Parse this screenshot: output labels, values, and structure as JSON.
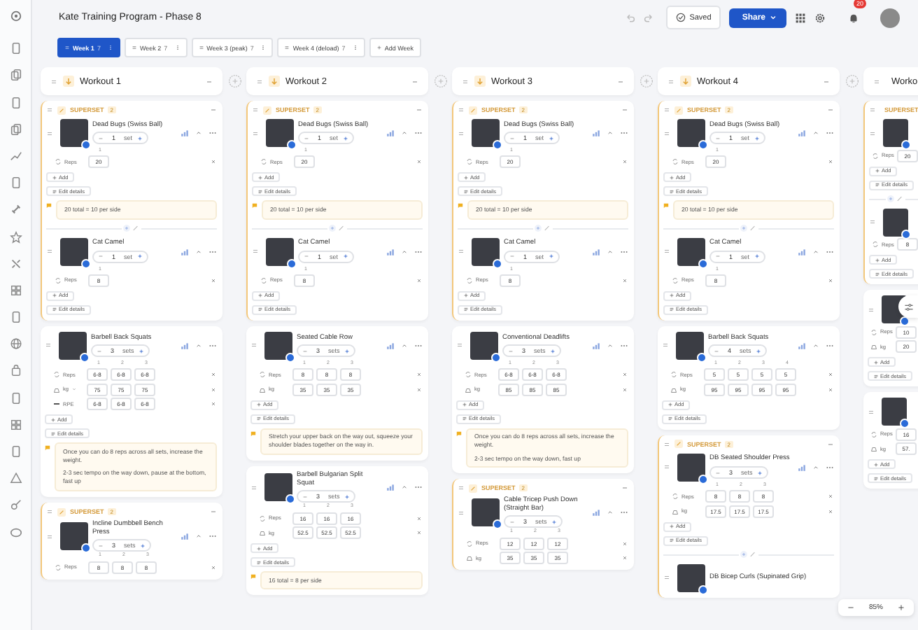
{
  "app_title": "Kate Training Program - Phase 8",
  "header": {
    "saved": "Saved",
    "share": "Share",
    "notifications": "20"
  },
  "weeks": [
    {
      "label": "Week 1",
      "count": "7",
      "selected": true
    },
    {
      "label": "Week 2",
      "count": "7",
      "selected": false
    },
    {
      "label": "Week 3 (peak)",
      "count": "7",
      "selected": false
    },
    {
      "label": "Week 4 (deload)",
      "count": "7",
      "selected": false
    }
  ],
  "add_week": "Add Week",
  "workouts": [
    {
      "title": "Workout 1",
      "blocks": [
        {
          "kind": "superset",
          "label": "SUPERSET",
          "count": "2",
          "exercises": [
            {
              "name": "Dead Bugs (Swiss Ball)",
              "sets": "1",
              "unit": "set",
              "set_numbers": [
                "1"
              ],
              "rows": [
                {
                  "kind": "reps",
                  "label": "Reps",
                  "values": [
                    "20"
                  ]
                }
              ],
              "add": "Add",
              "edit": "Edit details",
              "note": [
                "20 total = 10 per side"
              ]
            },
            {
              "name": "Cat Camel",
              "sets": "1",
              "unit": "set",
              "set_numbers": [
                "1"
              ],
              "rows": [
                {
                  "kind": "reps",
                  "label": "Reps",
                  "values": [
                    "8"
                  ]
                }
              ],
              "add": "Add",
              "edit": "Edit details"
            }
          ]
        },
        {
          "kind": "single",
          "exercises": [
            {
              "name": "Barbell Back Squats",
              "sets": "3",
              "unit": "sets",
              "set_numbers": [
                "1",
                "2",
                "3"
              ],
              "rows": [
                {
                  "kind": "reps",
                  "label": "Reps",
                  "values": [
                    "6-8",
                    "6-8",
                    "6-8"
                  ]
                },
                {
                  "kind": "weight",
                  "label": "kg",
                  "dropdown": true,
                  "values": [
                    "75",
                    "75",
                    "75"
                  ]
                },
                {
                  "kind": "rpe",
                  "label": "RPE",
                  "values": [
                    "6-8",
                    "6-8",
                    "6-8"
                  ]
                }
              ],
              "add": "Add",
              "edit": "Edit details",
              "note": [
                "Once you can do 8 reps across all sets, increase the weight.",
                "2-3 sec tempo on the way down, pause at the bottom, fast up"
              ]
            }
          ]
        },
        {
          "kind": "superset",
          "label": "SUPERSET",
          "count": "2",
          "exercises": [
            {
              "name": "Incline Dumbbell Bench Press",
              "sets": "3",
              "unit": "sets",
              "set_numbers": [
                "1",
                "2",
                "3"
              ],
              "rows": [
                {
                  "kind": "reps",
                  "label": "Reps",
                  "values": [
                    "8",
                    "8",
                    "8"
                  ]
                }
              ]
            }
          ]
        }
      ]
    },
    {
      "title": "Workout 2",
      "blocks": [
        {
          "kind": "superset",
          "label": "SUPERSET",
          "count": "2",
          "exercises": [
            {
              "name": "Dead Bugs (Swiss Ball)",
              "sets": "1",
              "unit": "set",
              "set_numbers": [
                "1"
              ],
              "rows": [
                {
                  "kind": "reps",
                  "label": "Reps",
                  "values": [
                    "20"
                  ]
                }
              ],
              "add": "Add",
              "edit": "Edit details",
              "note": [
                "20 total = 10 per side"
              ]
            },
            {
              "name": "Cat Camel",
              "sets": "1",
              "unit": "set",
              "set_numbers": [
                "1"
              ],
              "rows": [
                {
                  "kind": "reps",
                  "label": "Reps",
                  "values": [
                    "8"
                  ]
                }
              ],
              "add": "Add",
              "edit": "Edit details"
            }
          ]
        },
        {
          "kind": "single",
          "exercises": [
            {
              "name": "Seated Cable Row",
              "sets": "3",
              "unit": "sets",
              "set_numbers": [
                "1",
                "2",
                "3"
              ],
              "rows": [
                {
                  "kind": "reps",
                  "label": "Reps",
                  "values": [
                    "8",
                    "8",
                    "8"
                  ]
                },
                {
                  "kind": "weight",
                  "label": "kg",
                  "values": [
                    "35",
                    "35",
                    "35"
                  ]
                }
              ],
              "add": "Add",
              "edit": "Edit details",
              "note": [
                "Stretch your upper back on the way out, squeeze your shoulder blades together on the way in."
              ]
            }
          ]
        },
        {
          "kind": "single",
          "exercises": [
            {
              "name": "Barbell Bulgarian Split Squat",
              "sets": "3",
              "unit": "sets",
              "set_numbers": [
                "1",
                "2",
                "3"
              ],
              "rows": [
                {
                  "kind": "reps",
                  "label": "Reps",
                  "values": [
                    "16",
                    "16",
                    "16"
                  ]
                },
                {
                  "kind": "weight",
                  "label": "kg",
                  "values": [
                    "52.5",
                    "52.5",
                    "52.5"
                  ]
                }
              ],
              "add": "Add",
              "edit": "Edit details",
              "note": [
                "16 total = 8 per side"
              ]
            }
          ]
        }
      ]
    },
    {
      "title": "Workout 3",
      "blocks": [
        {
          "kind": "superset",
          "label": "SUPERSET",
          "count": "2",
          "exercises": [
            {
              "name": "Dead Bugs (Swiss Ball)",
              "sets": "1",
              "unit": "set",
              "set_numbers": [
                "1"
              ],
              "rows": [
                {
                  "kind": "reps",
                  "label": "Reps",
                  "values": [
                    "20"
                  ]
                }
              ],
              "add": "Add",
              "edit": "Edit details",
              "note": [
                "20 total = 10 per side"
              ]
            },
            {
              "name": "Cat Camel",
              "sets": "1",
              "unit": "set",
              "set_numbers": [
                "1"
              ],
              "rows": [
                {
                  "kind": "reps",
                  "label": "Reps",
                  "values": [
                    "8"
                  ]
                }
              ],
              "add": "Add",
              "edit": "Edit details"
            }
          ]
        },
        {
          "kind": "single",
          "exercises": [
            {
              "name": "Conventional Deadlifts",
              "sets": "3",
              "unit": "sets",
              "set_numbers": [
                "1",
                "2",
                "3"
              ],
              "rows": [
                {
                  "kind": "reps",
                  "label": "Reps",
                  "values": [
                    "6-8",
                    "6-8",
                    "6-8"
                  ]
                },
                {
                  "kind": "weight",
                  "label": "kg",
                  "values": [
                    "85",
                    "85",
                    "85"
                  ]
                }
              ],
              "add": "Add",
              "edit": "Edit details",
              "note": [
                "Once you can do 8 reps across all sets, increase the weight.",
                "2-3 sec tempo on the way down, fast up"
              ]
            }
          ]
        },
        {
          "kind": "superset",
          "label": "SUPERSET",
          "count": "2",
          "exercises": [
            {
              "name": "Cable Tricep Push Down (Straight Bar)",
              "sets": "3",
              "unit": "sets",
              "set_numbers": [
                "1",
                "2",
                "3"
              ],
              "rows": [
                {
                  "kind": "reps",
                  "label": "Reps",
                  "values": [
                    "12",
                    "12",
                    "12"
                  ]
                },
                {
                  "kind": "weight",
                  "label": "kg",
                  "values": [
                    "35",
                    "35",
                    "35"
                  ]
                }
              ]
            }
          ]
        }
      ]
    },
    {
      "title": "Workout 4",
      "blocks": [
        {
          "kind": "superset",
          "label": "SUPERSET",
          "count": "2",
          "exercises": [
            {
              "name": "Dead Bugs (Swiss Ball)",
              "sets": "1",
              "unit": "set",
              "set_numbers": [
                "1"
              ],
              "rows": [
                {
                  "kind": "reps",
                  "label": "Reps",
                  "values": [
                    "20"
                  ]
                }
              ],
              "add": "Add",
              "edit": "Edit details",
              "note": [
                "20 total = 10 per side"
              ]
            },
            {
              "name": "Cat Camel",
              "sets": "1",
              "unit": "set",
              "set_numbers": [
                "1"
              ],
              "rows": [
                {
                  "kind": "reps",
                  "label": "Reps",
                  "values": [
                    "8"
                  ]
                }
              ],
              "add": "Add",
              "edit": "Edit details"
            }
          ]
        },
        {
          "kind": "single",
          "exercises": [
            {
              "name": "Barbell Back Squats",
              "sets": "4",
              "unit": "sets",
              "set_numbers": [
                "1",
                "2",
                "3",
                "4"
              ],
              "rows": [
                {
                  "kind": "reps",
                  "label": "Reps",
                  "values": [
                    "5",
                    "5",
                    "5",
                    "5"
                  ]
                },
                {
                  "kind": "weight",
                  "label": "kg",
                  "values": [
                    "95",
                    "95",
                    "95",
                    "95"
                  ]
                }
              ],
              "add": "Add",
              "edit": "Edit details"
            }
          ]
        },
        {
          "kind": "superset",
          "label": "SUPERSET",
          "count": "2",
          "exercises": [
            {
              "name": "DB Seated Shoulder Press",
              "sets": "3",
              "unit": "sets",
              "set_numbers": [
                "1",
                "2",
                "3"
              ],
              "rows": [
                {
                  "kind": "reps",
                  "label": "Reps",
                  "values": [
                    "8",
                    "8",
                    "8"
                  ]
                },
                {
                  "kind": "weight",
                  "label": "kg",
                  "values": [
                    "17.5",
                    "17.5",
                    "17.5"
                  ]
                }
              ],
              "add": "Add",
              "edit": "Edit details"
            },
            {
              "name": "DB Bicep Curls (Supinated Grip)"
            }
          ]
        }
      ]
    },
    {
      "title": "Worko",
      "blocks": [
        {
          "kind": "superset",
          "label": "SUPERSET",
          "exercises": [
            {
              "rows": [
                {
                  "kind": "reps",
                  "label": "Reps",
                  "values": [
                    "20"
                  ]
                }
              ],
              "add": "Add",
              "edit": "Edit details"
            },
            {
              "rows": [
                {
                  "kind": "reps",
                  "label": "Reps",
                  "values": [
                    "8"
                  ]
                }
              ],
              "add": "Add",
              "edit": "Edit details"
            }
          ]
        },
        {
          "kind": "single",
          "exercises": [
            {
              "rows": [
                {
                  "kind": "reps",
                  "label": "Reps",
                  "values": [
                    "10"
                  ]
                },
                {
                  "kind": "weight",
                  "label": "kg",
                  "values": [
                    "20"
                  ]
                }
              ],
              "add": "Add",
              "edit": "Edit details"
            }
          ]
        },
        {
          "kind": "single",
          "exercises": [
            {
              "rows": [
                {
                  "kind": "reps",
                  "label": "Reps",
                  "values": [
                    "16"
                  ]
                },
                {
                  "kind": "weight",
                  "label": "kg",
                  "values": [
                    "57."
                  ]
                }
              ],
              "add": "Add",
              "edit": "Edit details"
            }
          ]
        }
      ]
    }
  ],
  "zoom": "85%"
}
